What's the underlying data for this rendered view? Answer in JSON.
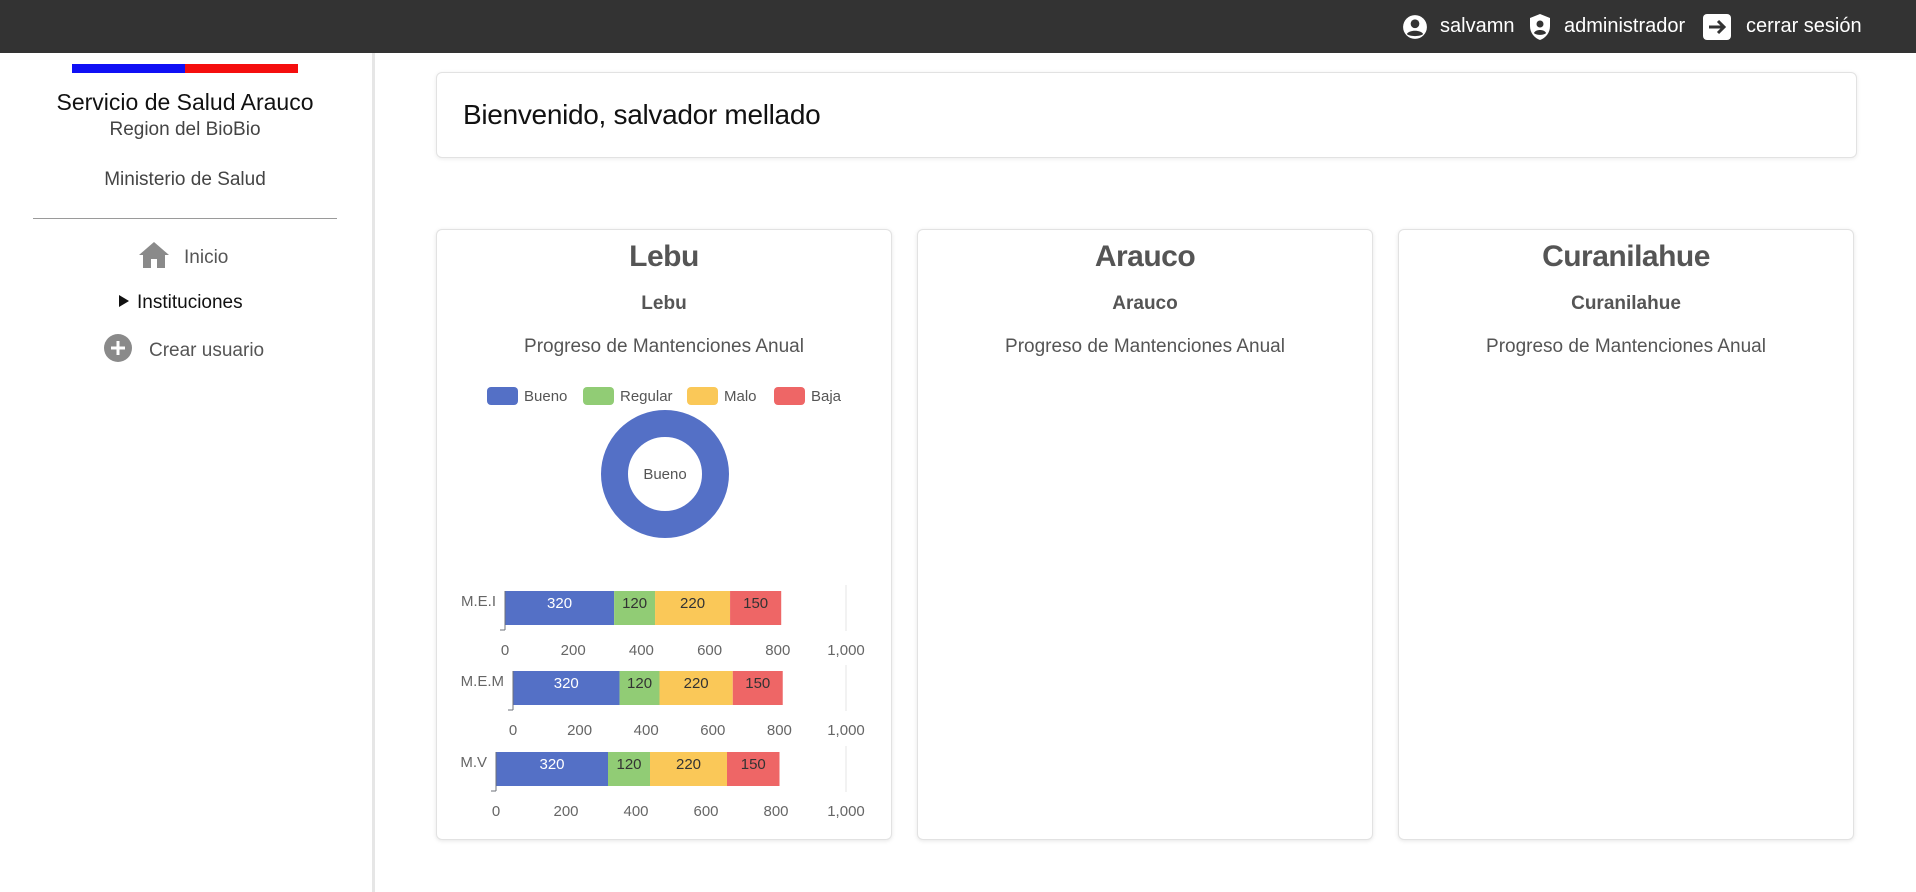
{
  "topbar": {
    "username": "salvamn",
    "role": "administrador",
    "logout_label": "cerrar sesión"
  },
  "sidebar": {
    "org_title": "Servicio de Salud Arauco",
    "org_region": "Region del BioBio",
    "org_ministry": "Ministerio de Salud",
    "flag_colors": [
      "#1010f5",
      "#f50e0e"
    ],
    "items": [
      {
        "label": "Inicio",
        "icon": "home-icon"
      },
      {
        "label": "Instituciones",
        "icon": "triangle-right-icon"
      },
      {
        "label": "Crear usuario",
        "icon": "plus-circle-icon"
      }
    ]
  },
  "welcome": {
    "text": "Bienvenido, salvador mellado"
  },
  "cards": [
    {
      "title": "Lebu",
      "subtitle": "Lebu",
      "progress_label": "Progreso de Mantenciones Anual"
    },
    {
      "title": "Arauco",
      "subtitle": "Arauco",
      "progress_label": "Progreso de Mantenciones Anual"
    },
    {
      "title": "Curanilahue",
      "subtitle": "Curanilahue",
      "progress_label": "Progreso de Mantenciones Anual"
    }
  ],
  "chart_data": [
    {
      "type": "pie",
      "variant": "donut",
      "legend": [
        "Bueno",
        "Regular",
        "Malo",
        "Baja"
      ],
      "legend_position": "top",
      "colors": [
        "#5470c6",
        "#91cc75",
        "#fac858",
        "#ee6666"
      ],
      "center_label": "Bueno",
      "values": [
        1,
        0,
        0,
        0
      ]
    },
    {
      "type": "bar",
      "orientation": "horizontal",
      "stacked": true,
      "categories": [
        "M.E.I"
      ],
      "series": [
        {
          "name": "Bueno",
          "values": [
            320
          ]
        },
        {
          "name": "Regular",
          "values": [
            120
          ]
        },
        {
          "name": "Malo",
          "values": [
            220
          ]
        },
        {
          "name": "Baja",
          "values": [
            150
          ]
        }
      ],
      "xlim": [
        0,
        1000
      ],
      "xticks": [
        "0",
        "200",
        "400",
        "600",
        "800",
        "1,000"
      ]
    },
    {
      "type": "bar",
      "orientation": "horizontal",
      "stacked": true,
      "categories": [
        "M.E.M"
      ],
      "series": [
        {
          "name": "Bueno",
          "values": [
            320
          ]
        },
        {
          "name": "Regular",
          "values": [
            120
          ]
        },
        {
          "name": "Malo",
          "values": [
            220
          ]
        },
        {
          "name": "Baja",
          "values": [
            150
          ]
        }
      ],
      "xlim": [
        0,
        1000
      ],
      "xticks": [
        "0",
        "200",
        "400",
        "600",
        "800",
        "1,000"
      ]
    },
    {
      "type": "bar",
      "orientation": "horizontal",
      "stacked": true,
      "categories": [
        "M.V"
      ],
      "series": [
        {
          "name": "Bueno",
          "values": [
            320
          ]
        },
        {
          "name": "Regular",
          "values": [
            120
          ]
        },
        {
          "name": "Malo",
          "values": [
            220
          ]
        },
        {
          "name": "Baja",
          "values": [
            150
          ]
        }
      ],
      "xlim": [
        0,
        1000
      ],
      "xticks": [
        "0",
        "200",
        "400",
        "600",
        "800",
        "1,000"
      ]
    }
  ]
}
